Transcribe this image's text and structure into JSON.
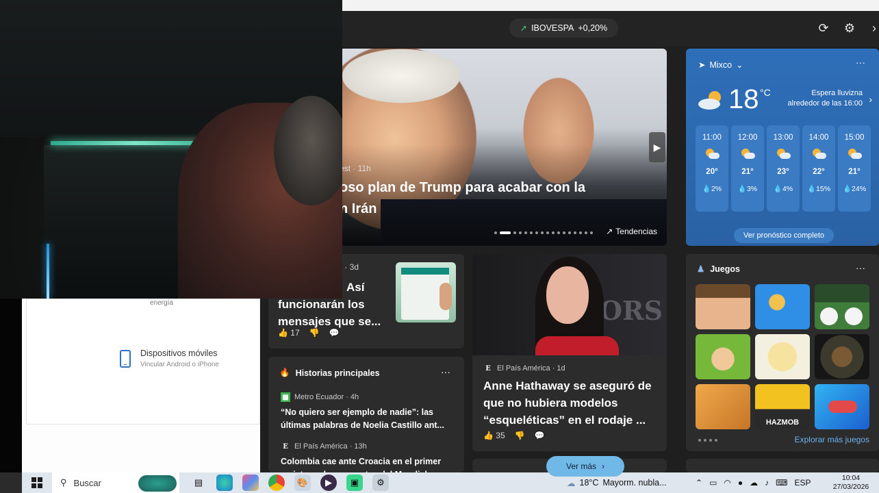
{
  "settings": {
    "energy_label": "energía",
    "devices_title": "Dispositivos móviles",
    "devices_subtitle": "Vincular Android o iPhone"
  },
  "topbar": {
    "ticker_name": "IBOVESPA",
    "ticker_change": "+0,20%",
    "refresh_icon": "refresh-icon",
    "settings_icon": "gear-icon"
  },
  "hero": {
    "source": "est · 11h",
    "title_line1": "oso plan de Trump para acabar con la",
    "title_line2": "n Irán",
    "trend_label": "Tendencias",
    "slides": 17,
    "active_slide": 1
  },
  "weather": {
    "location": "Mixco",
    "temperature": "18",
    "unit": "°C",
    "forecast_note_1": "Espera lluvizna",
    "forecast_note_2": "alrededor de las 16:00",
    "hours": [
      {
        "time": "11:00",
        "temp": "20°",
        "rain": "2%"
      },
      {
        "time": "12:00",
        "temp": "21°",
        "rain": "3%"
      },
      {
        "time": "13:00",
        "temp": "23°",
        "rain": "4%"
      },
      {
        "time": "14:00",
        "temp": "22°",
        "rain": "15%"
      },
      {
        "time": "15:00",
        "temp": "21°",
        "rain": "24%"
      }
    ],
    "full_forecast": "Ver pronóstico completo"
  },
  "whatsapp_card": {
    "source": "r · 3d",
    "title_1": "Así",
    "title_2": "funcionarán los",
    "title_3": "mensajes que se...",
    "likes": "17"
  },
  "top_stories": {
    "header": "Historias principales",
    "items": [
      {
        "source": "Metro Ecuador · 4h",
        "title": "“No quiero ser ejemplo de nadie”: las últimas palabras de Noelia Castillo ant..."
      },
      {
        "source": "El País América · 13h",
        "title": "Colombia cae ante Croacia en el primer amistoso de peso antes del Mundial"
      }
    ]
  },
  "ah_card": {
    "source": "El País América · 1d",
    "title": "Anne Hathaway se aseguró de que no hubiera modelos “esqueléticas” en el rodaje ...",
    "likes": "35",
    "backdrop_text": "HORS"
  },
  "games": {
    "header": "Juegos",
    "explore": "Explorar más juegos",
    "tile_label": "HAZMOB"
  },
  "more_button": "Ver más",
  "taskbar": {
    "search_placeholder": "Buscar",
    "weather_temp": "18°C",
    "weather_text": "Mayorm. nubla...",
    "language": "ESP",
    "time": "10:04",
    "date": "27/03/2026"
  }
}
